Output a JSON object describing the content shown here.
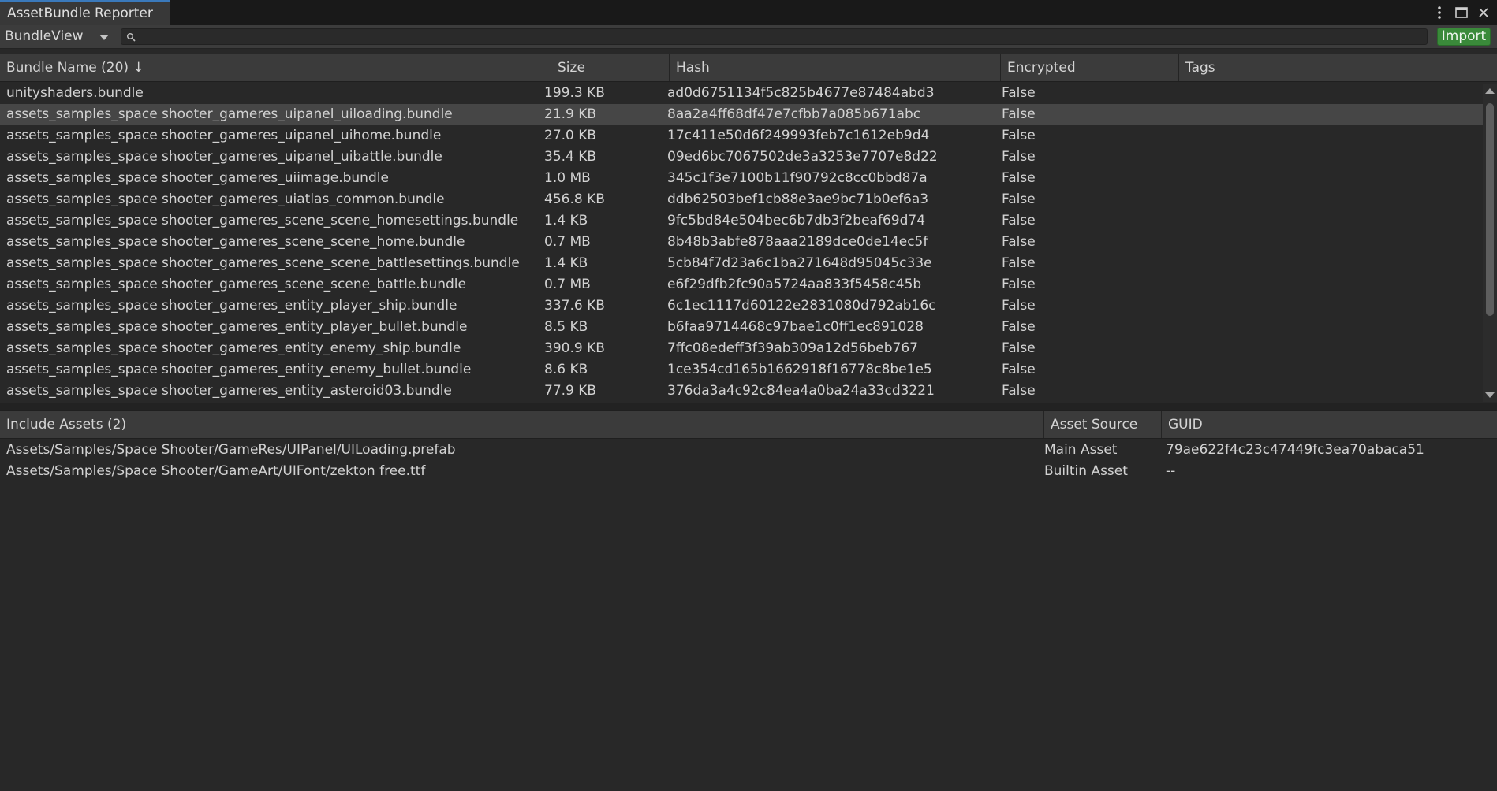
{
  "window": {
    "tab_title": "AssetBundle Reporter",
    "controls": [
      "kebab-menu-icon",
      "maximize-icon",
      "close-icon"
    ]
  },
  "toolbar": {
    "view_selected": "BundleView",
    "search_value": "",
    "import_label": "Import",
    "import_color": "#3a8a3a"
  },
  "bundles": {
    "headers": [
      "Bundle Name (20) ↓",
      "Size",
      "Hash",
      "Encrypted",
      "Tags"
    ],
    "rows": [
      {
        "name": "unityshaders.bundle",
        "size": "199.3 KB",
        "hash": "ad0d6751134f5c825b4677e87484abd3",
        "encrypted": "False",
        "tags": ""
      },
      {
        "name": "assets_samples_space shooter_gameres_uipanel_uiloading.bundle",
        "size": "21.9 KB",
        "hash": "8aa2a4ff68df47e7cfbb7a085b671abc",
        "encrypted": "False",
        "tags": ""
      },
      {
        "name": "assets_samples_space shooter_gameres_uipanel_uihome.bundle",
        "size": "27.0 KB",
        "hash": "17c411e50d6f249993feb7c1612eb9d4",
        "encrypted": "False",
        "tags": ""
      },
      {
        "name": "assets_samples_space shooter_gameres_uipanel_uibattle.bundle",
        "size": "35.4 KB",
        "hash": "09ed6bc7067502de3a3253e7707e8d22",
        "encrypted": "False",
        "tags": ""
      },
      {
        "name": "assets_samples_space shooter_gameres_uiimage.bundle",
        "size": "1.0 MB",
        "hash": "345c1f3e7100b11f90792c8cc0bbd87a",
        "encrypted": "False",
        "tags": ""
      },
      {
        "name": "assets_samples_space shooter_gameres_uiatlas_common.bundle",
        "size": "456.8 KB",
        "hash": "ddb62503bef1cb88e3ae9bc71b0ef6a3",
        "encrypted": "False",
        "tags": ""
      },
      {
        "name": "assets_samples_space shooter_gameres_scene_scene_homesettings.bundle",
        "size": "1.4 KB",
        "hash": "9fc5bd84e504bec6b7db3f2beaf69d74",
        "encrypted": "False",
        "tags": ""
      },
      {
        "name": "assets_samples_space shooter_gameres_scene_scene_home.bundle",
        "size": "0.7 MB",
        "hash": "8b48b3abfe878aaa2189dce0de14ec5f",
        "encrypted": "False",
        "tags": ""
      },
      {
        "name": "assets_samples_space shooter_gameres_scene_scene_battlesettings.bundle",
        "size": "1.4 KB",
        "hash": "5cb84f7d23a6c1ba271648d95045c33e",
        "encrypted": "False",
        "tags": ""
      },
      {
        "name": "assets_samples_space shooter_gameres_scene_scene_battle.bundle",
        "size": "0.7 MB",
        "hash": "e6f29dfb2fc90a5724aa833f5458c45b",
        "encrypted": "False",
        "tags": ""
      },
      {
        "name": "assets_samples_space shooter_gameres_entity_player_ship.bundle",
        "size": "337.6 KB",
        "hash": "6c1ec1117d60122e2831080d792ab16c",
        "encrypted": "False",
        "tags": ""
      },
      {
        "name": "assets_samples_space shooter_gameres_entity_player_bullet.bundle",
        "size": "8.5 KB",
        "hash": "b6faa9714468c97bae1c0ff1ec891028",
        "encrypted": "False",
        "tags": ""
      },
      {
        "name": "assets_samples_space shooter_gameres_entity_enemy_ship.bundle",
        "size": "390.9 KB",
        "hash": "7ffc08edeff3f39ab309a12d56beb767",
        "encrypted": "False",
        "tags": ""
      },
      {
        "name": "assets_samples_space shooter_gameres_entity_enemy_bullet.bundle",
        "size": "8.6 KB",
        "hash": "1ce354cd165b1662918f16778c8be1e5",
        "encrypted": "False",
        "tags": ""
      },
      {
        "name": "assets_samples_space shooter_gameres_entity_asteroid03.bundle",
        "size": "77.9 KB",
        "hash": "376da3a4c92c84ea4a0ba24a33cd3221",
        "encrypted": "False",
        "tags": ""
      }
    ],
    "selected_index": 1
  },
  "assets": {
    "headers": [
      "Include Assets (2)",
      "Asset Source",
      "GUID"
    ],
    "rows": [
      {
        "path": "Assets/Samples/Space Shooter/GameRes/UIPanel/UILoading.prefab",
        "source": "Main Asset",
        "guid": "79ae622f4c23c47449fc3ea70abaca51"
      },
      {
        "path": "Assets/Samples/Space Shooter/GameArt/UIFont/zekton free.ttf",
        "source": "Builtin Asset",
        "guid": "--"
      }
    ]
  }
}
